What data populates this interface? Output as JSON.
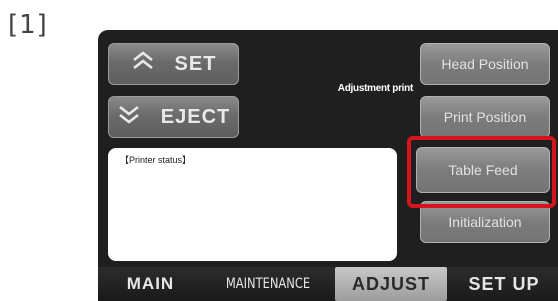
{
  "step_label": "[1]",
  "buttons": {
    "set": {
      "label": "SET",
      "icon": "chevron-double-up-icon"
    },
    "eject": {
      "label": "EJECT",
      "icon": "chevron-double-down-icon"
    }
  },
  "adjustment_print_label": "Adjustment print",
  "side_buttons": [
    {
      "label": "Head Position"
    },
    {
      "label": "Print Position"
    },
    {
      "label": "Table Feed"
    },
    {
      "label": "Initialization"
    }
  ],
  "printer_status": {
    "title": "【Printer status】"
  },
  "tabs": [
    {
      "label": "MAIN"
    },
    {
      "label": "MAINTENANCE"
    },
    {
      "label": "ADJUST",
      "selected": true
    },
    {
      "label": "SET UP"
    }
  ],
  "highlight_color": "#d5151c"
}
